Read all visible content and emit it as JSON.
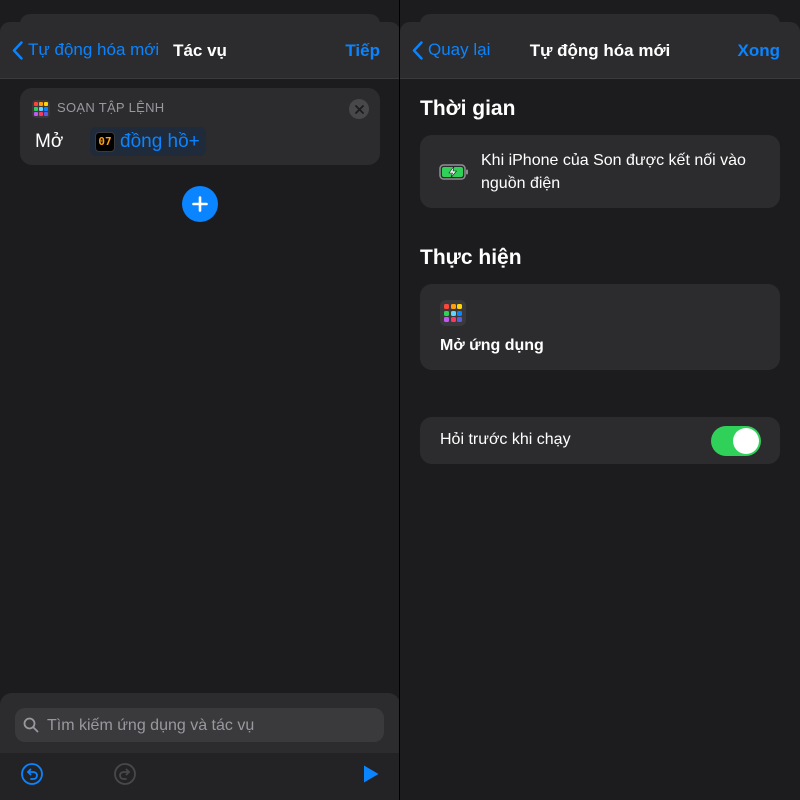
{
  "left": {
    "nav": {
      "back_label": "Tự động hóa mới",
      "title": "Tác vụ",
      "action_label": "Tiếp"
    },
    "action_card": {
      "category_label": "SOẠN TẬP LỆNH",
      "verb": "Mở",
      "app_icon_text": "07",
      "app_name": "đồng hồ+"
    },
    "search": {
      "placeholder": "Tìm kiếm ứng dụng và tác vụ",
      "value": ""
    },
    "toolbar": {
      "undo_icon": "undo-icon",
      "redo_icon": "redo-icon",
      "run_icon": "play-icon"
    }
  },
  "right": {
    "nav": {
      "back_label": "Quay lại",
      "title": "Tự động hóa mới",
      "action_label": "Xong"
    },
    "time_section": {
      "title": "Thời gian",
      "trigger_text": "Khi iPhone của Son được kết nối vào nguồn điện",
      "trigger_icon": "battery-charging-icon"
    },
    "do_section": {
      "title": "Thực hiện",
      "action_label": "Mở ứng dụng",
      "action_icon": "apps-grid-icon"
    },
    "ask_before_running": {
      "label": "Hỏi trước khi chạy",
      "enabled": true
    }
  },
  "colors": {
    "accent": "#0a84ff",
    "toggle_on": "#30d158",
    "background": "#1c1c1e",
    "card": "#2c2c2e"
  }
}
